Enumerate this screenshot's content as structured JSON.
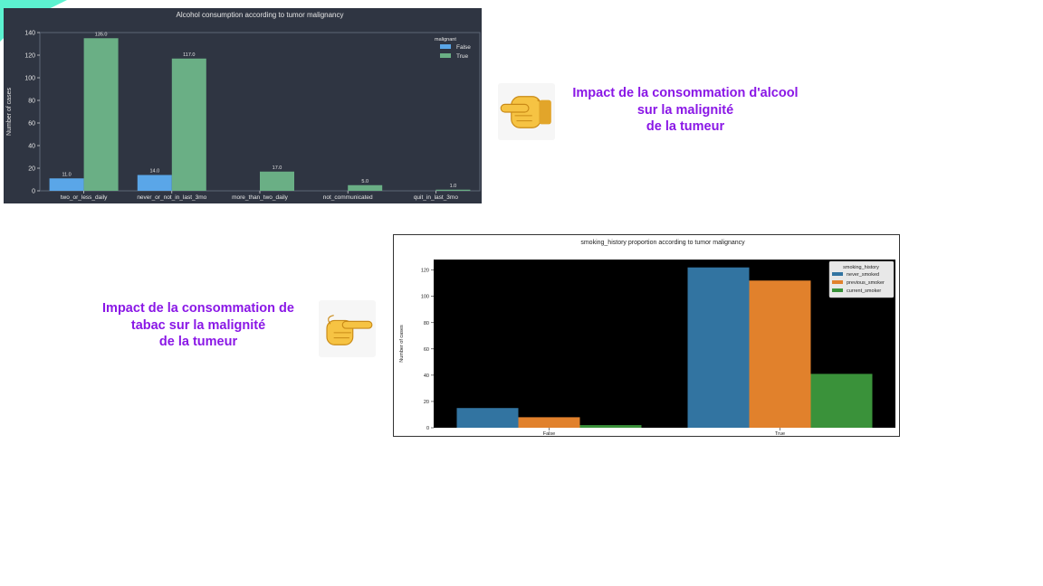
{
  "colors": {
    "accent_text": "#8a17e6",
    "chart1_bg": "#2f3542",
    "chart1_false": "#5aa6e8",
    "chart1_true": "#6aaf85",
    "chart2_plot_bg": "#000000",
    "chart2_never": "#3274a1",
    "chart2_previous": "#e1812c",
    "chart2_current": "#3a923a",
    "corner_shape": "#3ff0c8",
    "hand_skin": "#f6c343"
  },
  "icons": {
    "pointer_left": "backhand-index-pointing-left-icon",
    "pointer_right": "backhand-index-pointing-right-icon"
  },
  "captions": {
    "alcohol": {
      "line1": "Impact de la consommation d'alcool",
      "line2": "sur la malignité",
      "line3": "de la tumeur"
    },
    "smoking": {
      "line1": "Impact de la consommation de",
      "line2": "tabac sur la malignité",
      "line3": "de la tumeur"
    }
  },
  "chart_data": [
    {
      "type": "bar",
      "title": "Alcohol consumption according to tumor malignancy",
      "xlabel": "",
      "ylabel": "Number of cases",
      "ylim": [
        0,
        140
      ],
      "yticks": [
        0,
        20,
        40,
        60,
        80,
        100,
        120,
        140
      ],
      "grid": false,
      "legend_title": "malignant",
      "legend_position": "top-right",
      "categories": [
        "two_or_less_daily",
        "never_or_not_in_last_3mo",
        "more_than_two_daily",
        "not_communicated",
        "quit_in_last_3mo"
      ],
      "series": [
        {
          "name": "False",
          "values": [
            11.0,
            14.0,
            null,
            null,
            null
          ],
          "labels": [
            "11.0",
            "14.0",
            "",
            "",
            ""
          ]
        },
        {
          "name": "True",
          "values": [
            135.0,
            117.0,
            17.0,
            5.0,
            1.0
          ],
          "labels": [
            "135.0",
            "117.0",
            "17.0",
            "5.0",
            "1.0"
          ]
        }
      ]
    },
    {
      "type": "bar",
      "title": "smoking_history proportion according to tumor malignancy",
      "xlabel": "",
      "ylabel": "Number of cases",
      "ylim": [
        0,
        128
      ],
      "yticks": [
        0,
        20,
        40,
        60,
        80,
        100,
        120
      ],
      "grid": false,
      "legend_title": "smoking_history",
      "legend_position": "top-right",
      "categories": [
        "False",
        "True"
      ],
      "series": [
        {
          "name": "never_smoked",
          "values": [
            15,
            122
          ]
        },
        {
          "name": "previous_smoker",
          "values": [
            8,
            112
          ]
        },
        {
          "name": "current_smoker",
          "values": [
            2,
            41
          ]
        }
      ]
    }
  ]
}
